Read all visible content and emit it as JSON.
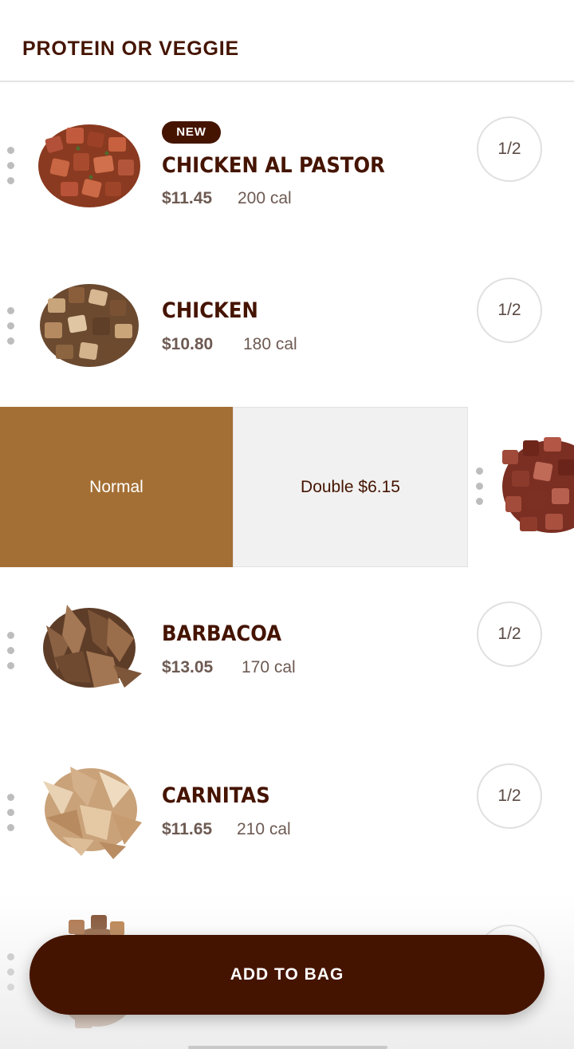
{
  "header": {
    "title": "PROTEIN OR VEGGIE"
  },
  "items": [
    {
      "badge": "NEW",
      "name": "CHICKEN AL PASTOR",
      "price": "$11.45",
      "calories": "200 cal",
      "half_label": "1/2",
      "icon": "al-pastor-image"
    },
    {
      "name": "CHICKEN",
      "price": "$10.80",
      "calories": "180 cal",
      "half_label": "1/2",
      "icon": "chicken-image"
    },
    {
      "name": "BARBACOA",
      "price": "$13.05",
      "calories": "170 cal",
      "half_label": "1/2",
      "icon": "barbacoa-image"
    },
    {
      "name": "CARNITAS",
      "price": "$11.65",
      "calories": "210 cal",
      "half_label": "1/2",
      "icon": "carnitas-image"
    }
  ],
  "portion_options": {
    "normal_label": "Normal",
    "double_label": "Double $6.15",
    "selected": "Normal"
  },
  "footer": {
    "add_to_bag_label": "ADD TO BAG"
  },
  "colors": {
    "brand_brown": "#451400",
    "selected_option": "#a46f35",
    "option_bg": "#f1f1f1",
    "divider": "#e3e3e3"
  }
}
